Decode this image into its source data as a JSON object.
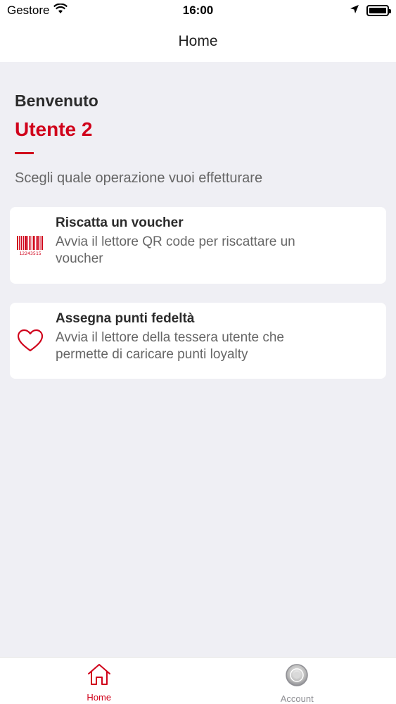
{
  "status_bar": {
    "carrier": "Gestore",
    "time": "16:00"
  },
  "nav": {
    "title": "Home"
  },
  "welcome": {
    "greeting": "Benvenuto",
    "user": "Utente 2",
    "subtitle": "Scegli quale operazione vuoi effetturare"
  },
  "cards": [
    {
      "title": "Riscatta un voucher",
      "description": "Avvia il lettore QR code per riscattare un voucher",
      "icon": "barcode-icon",
      "barcode_digits": "12243515"
    },
    {
      "title": "Assegna punti fedeltà",
      "description": "Avvia il lettore della tessera utente che permette di caricare punti loyalty",
      "icon": "heart-icon"
    }
  ],
  "tabs": [
    {
      "label": "Home",
      "icon": "home-icon",
      "active": true
    },
    {
      "label": "Account",
      "icon": "account-icon",
      "active": false
    }
  ],
  "colors": {
    "accent": "#d0021b",
    "background": "#efeff4",
    "inactive_tab": "#8e8e93"
  }
}
